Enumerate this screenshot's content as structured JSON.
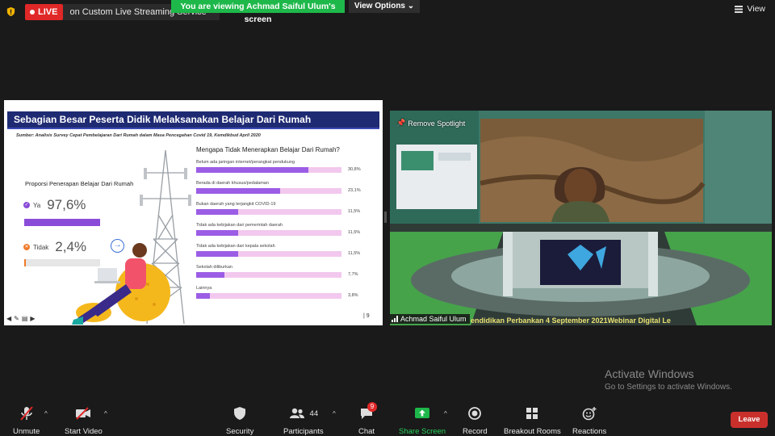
{
  "topbar": {
    "live_badge": "LIVE",
    "live_service": "on Custom Live Streaming Service",
    "viewing_banner": "You are viewing Achmad Saiful Ulum's screen",
    "view_options": "View Options",
    "view": "View"
  },
  "slide": {
    "title": "Sebagian Besar Peserta Didik Melaksanakan Belajar Dari Rumah",
    "source": "Sumber: Analisis Survey Cepat Pembelajaran Dari Rumah dalam Masa Pencegahan Covid 19, Kemdikbud April 2020",
    "proporsi_title": "Proporsi Penerapan Belajar Dari Rumah",
    "ya_label": "Ya",
    "ya_value": "97,6%",
    "ya_fraction": 0.976,
    "tidak_label": "Tidak",
    "tidak_value": "2,4%",
    "tidak_fraction": 0.024,
    "question": "Mengapa Tidak Menerapkan Belajar Dari Rumah?",
    "reasons": [
      {
        "label": "Belum ada jaringan internet/perangkat pendukung",
        "pct": "30,8%",
        "value": 30.8
      },
      {
        "label": "Berada di daerah khusus/pedalaman",
        "pct": "23,1%",
        "value": 23.1
      },
      {
        "label": "Bukan daerah yang terjangkit COVID-19",
        "pct": "11,5%",
        "value": 11.5
      },
      {
        "label": "Tidak ada kebijakan dari pemerintah daerah",
        "pct": "11,5%",
        "value": 11.5
      },
      {
        "label": "Tidak ada kebijakan dari kepala sekolah",
        "pct": "11,5%",
        "value": 11.5
      },
      {
        "label": "Sekolah diliburkan",
        "pct": "7,7%",
        "value": 7.7
      },
      {
        "label": "Lainnya",
        "pct": "3,8%",
        "value": 3.8
      }
    ],
    "page_number": "9"
  },
  "video": {
    "spotlight": "Remove Spotlight",
    "participant_name": "Achmad Saiful Ulum",
    "ticker": "endidikan Perbankan 4 September 2021Webinar Digital Le"
  },
  "watermark": {
    "title": "Activate Windows",
    "subtitle": "Go to Settings to activate Windows."
  },
  "toolbar": {
    "unmute": "Unmute",
    "start_video": "Start Video",
    "security": "Security",
    "participants": "Participants",
    "participants_count": "44",
    "chat": "Chat",
    "chat_badge": "9",
    "share_screen": "Share Screen",
    "record": "Record",
    "breakout_rooms": "Breakout Rooms",
    "reactions": "Reactions",
    "leave": "Leave"
  },
  "colors": {
    "live_red": "#e02828",
    "banner_green": "#1eb84a",
    "slide_header": "#1e2a72",
    "bar_purple": "#9b5de5",
    "bar_track": "#f2c8ee",
    "tidak_orange": "#f07b2a",
    "leave_red": "#c9302c"
  }
}
